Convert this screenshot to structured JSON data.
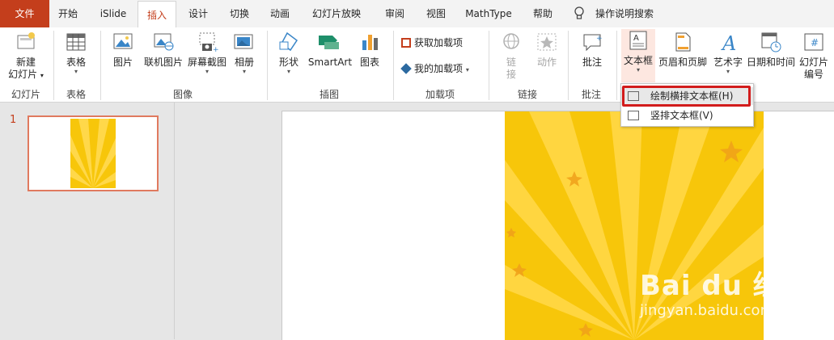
{
  "tabs": {
    "file": "文件",
    "home": "开始",
    "islide": "iSlide",
    "insert": "插入",
    "design": "设计",
    "transitions": "切换",
    "animations": "动画",
    "slideshow": "幻灯片放映",
    "review": "审阅",
    "view": "视图",
    "mathtype": "MathType",
    "help": "帮助",
    "tell_me": "操作说明搜索"
  },
  "ribbon": {
    "new_slide_1": "新建",
    "new_slide_2": "幻灯片",
    "table": "表格",
    "picture": "图片",
    "online_picture": "联机图片",
    "screenshot": "屏幕截图",
    "album": "相册",
    "shapes": "形状",
    "smartart": "SmartArt",
    "chart": "图表",
    "get_addins": "获取加载项",
    "my_addins": "我的加载项",
    "link_1": "链",
    "link_2": "接",
    "action": "动作",
    "comment": "批注",
    "textbox": "文本框",
    "header_footer": "页眉和页脚",
    "wordart": "艺术字",
    "datetime": "日期和时间",
    "slide_number_1": "幻灯片",
    "slide_number_2": "编号"
  },
  "groups": {
    "slides": "幻灯片",
    "tables": "表格",
    "images": "图像",
    "illustrations": "插图",
    "addins": "加载项",
    "links": "链接",
    "comments": "批注"
  },
  "dropdown": {
    "horizontal": "绘制横排文本框(H)",
    "vertical": "竖排文本框(V)"
  },
  "thumbnail": {
    "number": "1"
  },
  "watermark": {
    "brand": "Bai du 经验",
    "url": "jingyan.baidu.com"
  },
  "colors": {
    "accent": "#c43e1c",
    "highlight": "#d21c1c",
    "slide_yellow": "#f7c60a"
  }
}
